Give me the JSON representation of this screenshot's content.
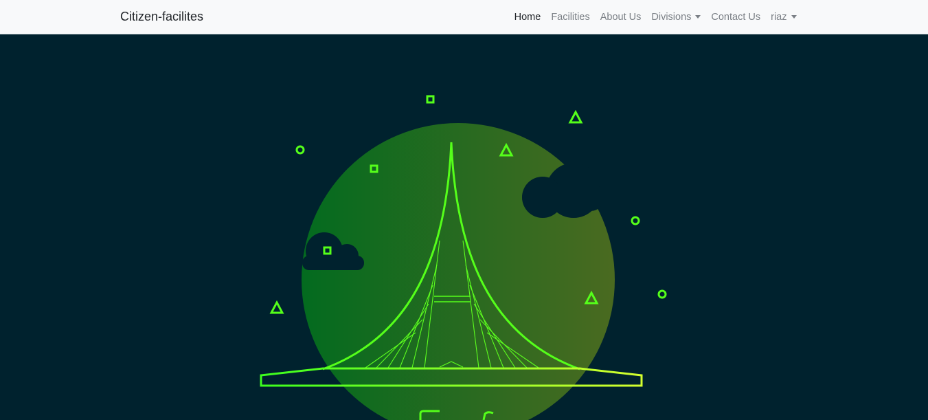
{
  "navbar": {
    "brand": "Citizen-facilites",
    "items": [
      {
        "label": "Home",
        "active": true,
        "dropdown": false
      },
      {
        "label": "Facilities",
        "active": false,
        "dropdown": false
      },
      {
        "label": "About Us",
        "active": false,
        "dropdown": false
      },
      {
        "label": "Divisions",
        "active": false,
        "dropdown": true
      },
      {
        "label": "Contact Us",
        "active": false,
        "dropdown": false
      },
      {
        "label": "riaz",
        "active": false,
        "dropdown": true
      }
    ]
  },
  "hero": {
    "illustration": "bridge-illustration",
    "colors": {
      "background": "#00222e",
      "neon": "#55ff1a",
      "neon_yellow": "#c8ff33",
      "disc_left": "#036b1f",
      "disc_right": "#4a6a20"
    }
  }
}
